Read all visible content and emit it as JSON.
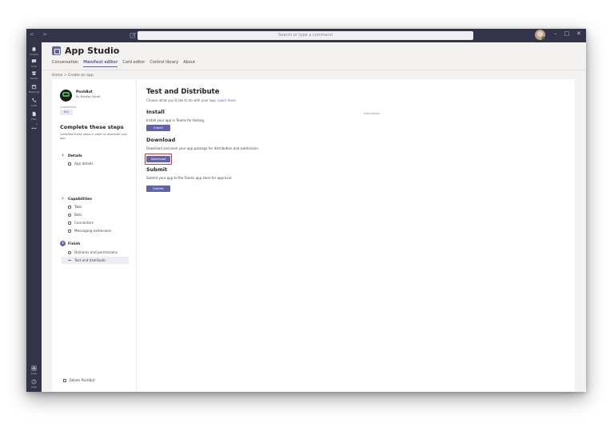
{
  "topbar": {
    "search_placeholder": "Search or type a command",
    "nav_arrows": "< >",
    "window_controls": [
      "–",
      "□",
      "✕"
    ]
  },
  "rail": {
    "items": [
      {
        "label": "Activity",
        "icon": "bell-icon"
      },
      {
        "label": "Chat",
        "icon": "chat-icon"
      },
      {
        "label": "Teams",
        "icon": "teams-icon"
      },
      {
        "label": "Meetings",
        "icon": "calendar-icon"
      },
      {
        "label": "Calls",
        "icon": "phone-icon"
      },
      {
        "label": "Files",
        "icon": "file-icon"
      },
      {
        "label": "",
        "icon": "more-icon"
      },
      {
        "label": "Apps",
        "icon": "apps-icon"
      },
      {
        "label": "Help",
        "icon": "help-icon"
      }
    ]
  },
  "app": {
    "title": "App Studio",
    "tabs": [
      "Conversation",
      "Manifest editor",
      "Card editor",
      "Control library",
      "About"
    ],
    "active_tab": "Manifest editor",
    "breadcrumb": "Home  >  Create an app"
  },
  "left_panel": {
    "bot_name": "PoshBot",
    "bot_author": "By Bradley Wyatt",
    "capabilities_label": "Capabilities",
    "capability_badge": "Bot",
    "steps_title": "Complete these steps",
    "steps_subtitle": "Complete these steps in order to distribute your app.",
    "sections": [
      {
        "number": "1",
        "label": "Details",
        "steps": [
          "App details"
        ]
      },
      {
        "number": "2",
        "label": "Capabilities",
        "steps": [
          "Tabs",
          "Bots",
          "Connectors",
          "Messaging extensions"
        ]
      },
      {
        "number": "3",
        "label": "Finish",
        "steps": [
          "Domains and permissions",
          "Test and distribute"
        ]
      }
    ],
    "active_step": "Test and distribute",
    "delete_label": "Delete PoshBot"
  },
  "main": {
    "title": "Test and Distribute",
    "subtitle": "Choose what you'd like to do with your app.",
    "learn_more": "Learn more",
    "description_label": "Description",
    "install": {
      "heading": "Install",
      "text": "Install your app in Teams for testing.",
      "button": "Install"
    },
    "download": {
      "heading": "Download",
      "text": "Download and save your app package for distribution and submission.",
      "button": "Download"
    },
    "submit": {
      "heading": "Submit",
      "text": "Submit your app to the Teams app store for approval.",
      "button": "Submit"
    }
  },
  "colors": {
    "accent": "#6264a7",
    "rail": "#33344a",
    "highlight": "#d13438"
  }
}
